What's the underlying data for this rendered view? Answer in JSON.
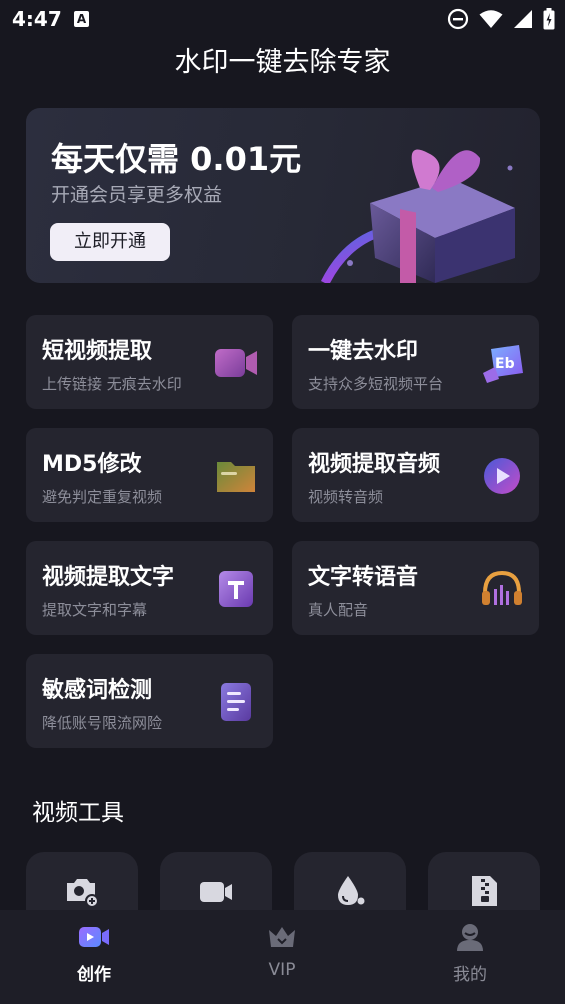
{
  "status_bar": {
    "time": "4:47",
    "notification": "A"
  },
  "app": {
    "title": "水印一键去除专家"
  },
  "banner": {
    "price_text": "每天仅需 0.01元",
    "subtitle": "开通会员享更多权益",
    "button_label": "立即开通"
  },
  "cards": [
    {
      "title": "短视频提取",
      "subtitle": "上传链接 无痕去水印",
      "icon": "video-camera-icon"
    },
    {
      "title": "一键去水印",
      "subtitle": "支持众多短视频平台",
      "icon": "eraser-icon"
    },
    {
      "title": "MD5修改",
      "subtitle": "避免判定重复视频",
      "icon": "folder-icon"
    },
    {
      "title": "视频提取音频",
      "subtitle": "视频转音频",
      "icon": "audio-play-icon"
    },
    {
      "title": "视频提取文字",
      "subtitle": "提取文字和字幕",
      "icon": "text-icon"
    },
    {
      "title": "文字转语音",
      "subtitle": "真人配音",
      "icon": "headphones-icon"
    },
    {
      "title": "敏感词检测",
      "subtitle": "降低账号限流网险",
      "icon": "document-icon"
    }
  ],
  "video_tools": {
    "title": "视频工具",
    "items": [
      "camera-add-icon",
      "video-icon",
      "watermark-drop-icon",
      "zip-file-icon"
    ]
  },
  "bottom_nav": {
    "items": [
      {
        "label": "创作",
        "icon": "create-video-icon",
        "active": true
      },
      {
        "label": "VIP",
        "icon": "crown-icon",
        "active": false
      },
      {
        "label": "我的",
        "icon": "profile-icon",
        "active": false
      }
    ]
  },
  "colors": {
    "background": "#17171f",
    "card": "#25252f",
    "accent_purple": "#8a5cf0",
    "text_secondary": "#8d8e9a"
  }
}
